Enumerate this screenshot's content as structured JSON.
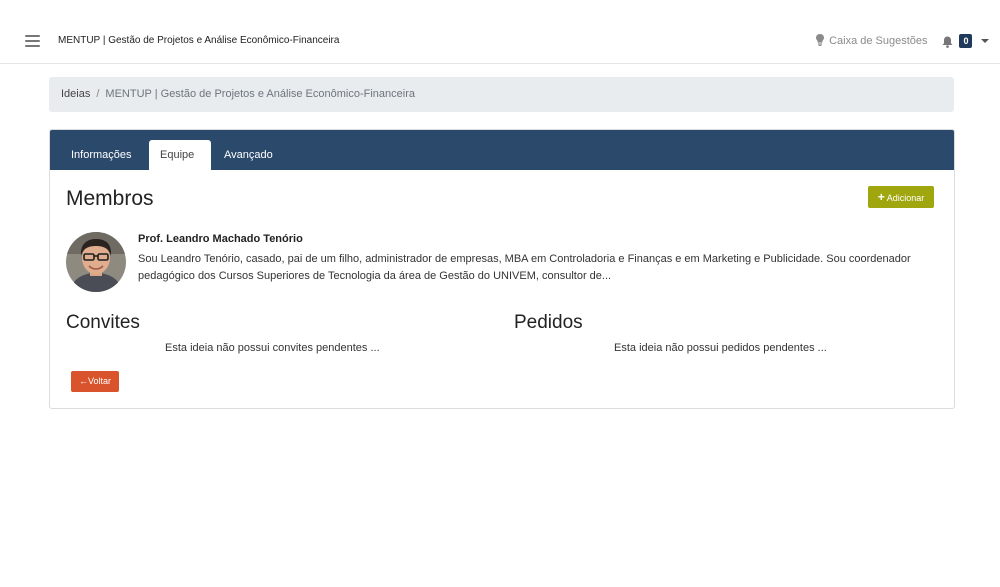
{
  "navbar": {
    "app_title": "MENTUP | Gestão de Projetos e Análise Econômico-Financeira",
    "suggestions_label": "Caixa de Sugestões",
    "notification_count": "0"
  },
  "breadcrumb": {
    "items": [
      "Ideias",
      "MENTUP | Gestão de Projetos e Análise Econômico-Financeira"
    ],
    "separator": "/"
  },
  "tabs": [
    {
      "label": "Informações",
      "active": false
    },
    {
      "label": "Equipe",
      "active": true
    },
    {
      "label": "Avançado",
      "active": false
    }
  ],
  "members": {
    "title": "Membros",
    "add_label": "Adicionar",
    "add_icon": "+",
    "list": [
      {
        "name": "Prof. Leandro Machado Tenório",
        "bio": "Sou Leandro Tenório, casado, pai de um filho, administrador de empresas, MBA em Controladoria e Finanças e em Marketing e Publicidade. Sou coordenador pedagógico dos Cursos Superiores de Tecnologia da área de Gestão do UNIVEM, consultor de..."
      }
    ]
  },
  "invites": {
    "title": "Convites",
    "empty_text": "Esta ideia não possui convites pendentes ..."
  },
  "requests": {
    "title": "Pedidos",
    "empty_text": "Esta ideia não possui pedidos pendentes ..."
  },
  "back_button": {
    "label": "Voltar",
    "icon": "←"
  },
  "colors": {
    "header": "#2b4a6b",
    "add_button": "#a0a60e",
    "back_button": "#d9532c",
    "badge": "#1f3a5b"
  }
}
